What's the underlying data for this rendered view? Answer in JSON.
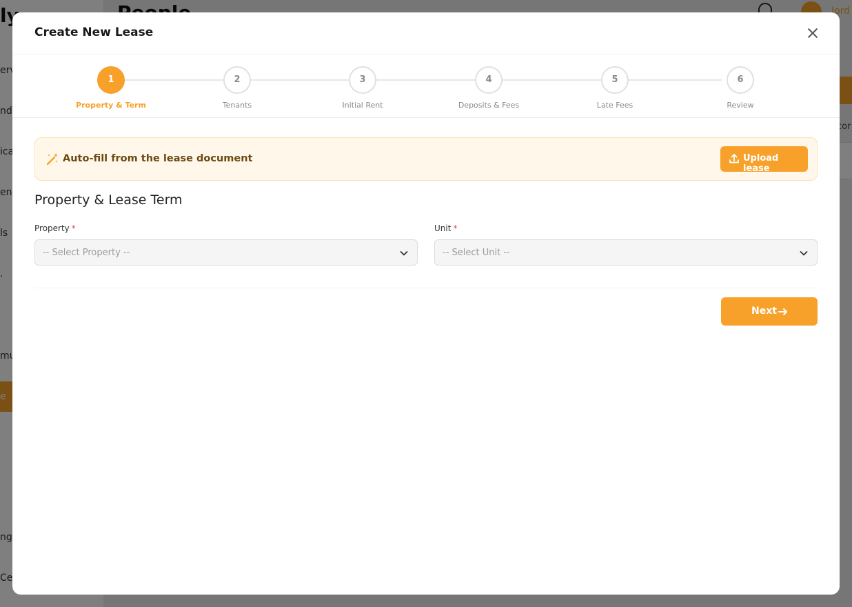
{
  "background": {
    "app_logo_fragment": "ly",
    "page_title": "People",
    "user_name_fragment": "Jord",
    "nav_fragments": [
      "ervie",
      "nda",
      "icat",
      "ena",
      "ls",
      ".",
      "mun",
      "e",
      "ngs",
      "Cen"
    ],
    "right_fragment": "cor"
  },
  "modal": {
    "title": "Create New Lease",
    "close_icon": "close-icon"
  },
  "stepper": {
    "steps": [
      {
        "number": "1",
        "label": "Property & Term",
        "active": true
      },
      {
        "number": "2",
        "label": "Tenants",
        "active": false
      },
      {
        "number": "3",
        "label": "Initial Rent",
        "active": false
      },
      {
        "number": "4",
        "label": "Deposits & Fees",
        "active": false
      },
      {
        "number": "5",
        "label": "Late Fees",
        "active": false
      },
      {
        "number": "6",
        "label": "Review",
        "active": false
      }
    ]
  },
  "autofill": {
    "icon": "magic-wand-icon",
    "text": "Auto-fill from the lease document",
    "upload_icon": "upload-icon",
    "upload_label": "Upload lease"
  },
  "section": {
    "title": "Property & Lease Term"
  },
  "fields": {
    "property": {
      "label": "Property",
      "required_mark": "*",
      "value": "-- Select Property --"
    },
    "unit": {
      "label": "Unit",
      "required_mark": "*",
      "value": "-- Select Unit --"
    }
  },
  "footer": {
    "next_label": "Next"
  },
  "colors": {
    "accent": "#f7a12a",
    "banner_bg": "#fff7ea",
    "banner_text": "#6b4a12",
    "required": "#e5484d"
  }
}
